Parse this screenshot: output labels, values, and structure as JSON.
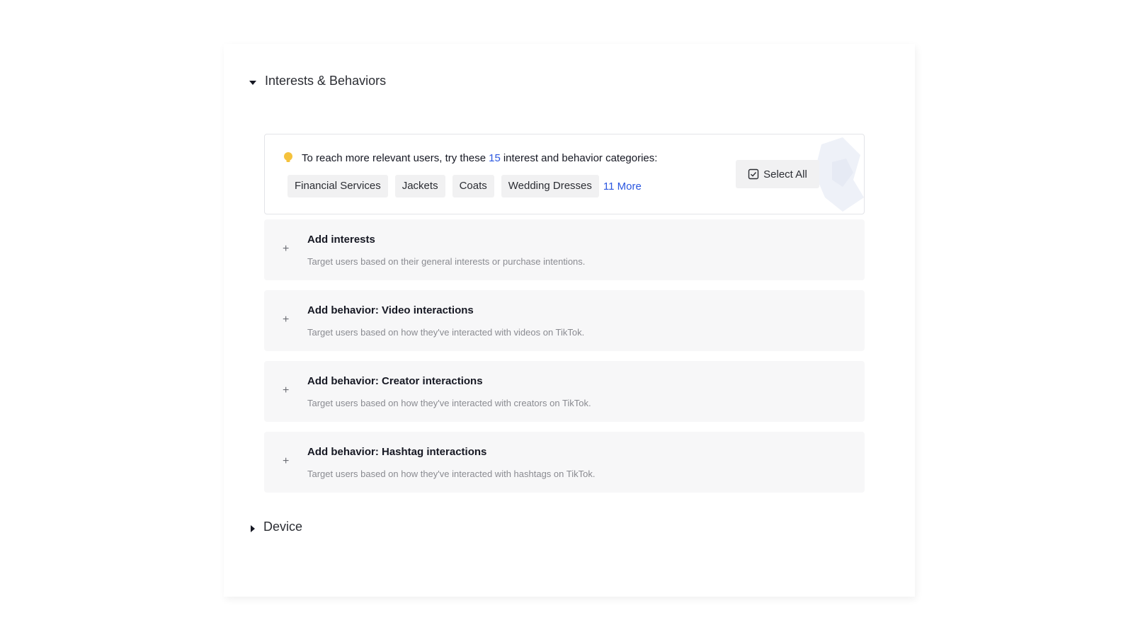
{
  "sections": {
    "interests": {
      "title": "Interests & Behaviors",
      "expanded": true
    },
    "device": {
      "title": "Device",
      "expanded": false
    }
  },
  "suggestion": {
    "text_before": "To reach more relevant users, try these",
    "count": "15",
    "text_after": "interest and behavior categories:",
    "chips": [
      "Financial Services",
      "Jackets",
      "Coats",
      "Wedding Dresses"
    ],
    "more_label": "11 More",
    "select_all_label": "Select All",
    "bulb_color": "#f5c23c",
    "link_color": "#2b57e0"
  },
  "add_cards": [
    {
      "title": "Add interests",
      "description": "Target users based on their general interests or purchase intentions."
    },
    {
      "title": "Add behavior: Video interactions",
      "description": "Target users based on how they've interacted with videos on TikTok."
    },
    {
      "title": "Add behavior: Creator interactions",
      "description": "Target users based on how they've interacted with creators on TikTok."
    },
    {
      "title": "Add behavior: Hashtag interactions",
      "description": "Target users based on how they've interacted with hashtags on TikTok."
    }
  ],
  "icons": {
    "collapse": "caret-down-icon",
    "expand": "caret-right-icon",
    "bulb": "lightbulb-icon",
    "select_all": "checkbox-select-icon",
    "add": "plus-icon",
    "plus_glyph": "+"
  }
}
